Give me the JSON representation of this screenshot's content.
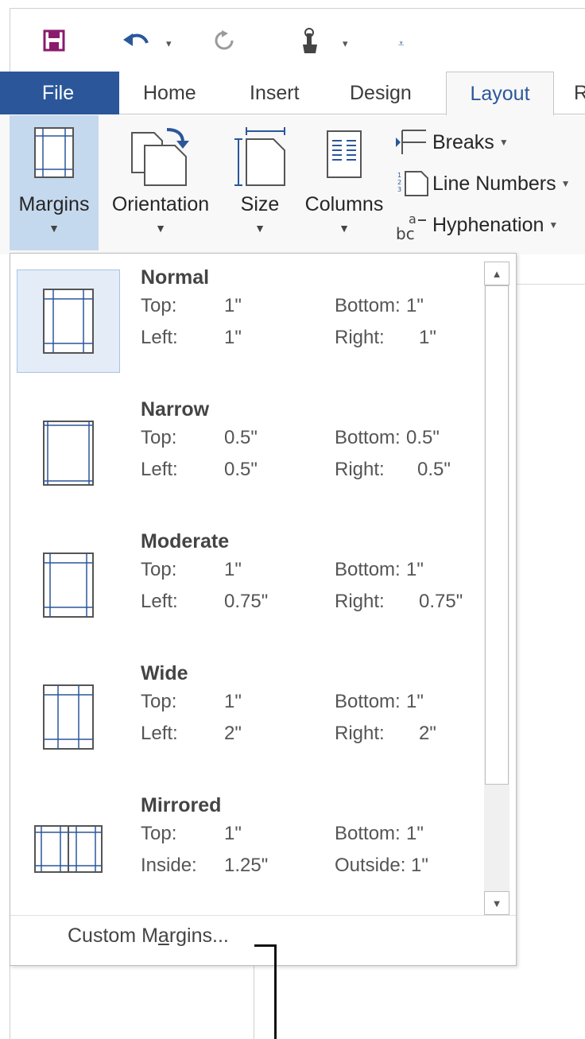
{
  "quick_access": {
    "save_icon": "save-icon",
    "undo_icon": "undo-icon",
    "redo_icon": "redo-icon",
    "touch_icon": "touch-mode-icon",
    "customize_icon": "customize-icon"
  },
  "tabs": {
    "file": "File",
    "home": "Home",
    "insert": "Insert",
    "design": "Design",
    "layout": "Layout",
    "next": "R"
  },
  "ribbon": {
    "margins": "Margins",
    "orientation": "Orientation",
    "size": "Size",
    "columns": "Columns",
    "breaks": "Breaks",
    "line_numbers": "Line Numbers",
    "hyphenation": "Hyphenation"
  },
  "margins_gallery": {
    "items": [
      {
        "name": "Normal",
        "k1": "Top:",
        "v1": "1\"",
        "k2": "Bottom:",
        "v2": "1\"",
        "k3": "Left:",
        "v3": "1\"",
        "k4": "Right:",
        "v4": "1\""
      },
      {
        "name": "Narrow",
        "k1": "Top:",
        "v1": "0.5\"",
        "k2": "Bottom:",
        "v2": "0.5\"",
        "k3": "Left:",
        "v3": "0.5\"",
        "k4": "Right:",
        "v4": "0.5\""
      },
      {
        "name": "Moderate",
        "k1": "Top:",
        "v1": "1\"",
        "k2": "Bottom:",
        "v2": "1\"",
        "k3": "Left:",
        "v3": "0.75\"",
        "k4": "Right:",
        "v4": "0.75\""
      },
      {
        "name": "Wide",
        "k1": "Top:",
        "v1": "1\"",
        "k2": "Bottom:",
        "v2": "1\"",
        "k3": "Left:",
        "v3": "2\"",
        "k4": "Right:",
        "v4": "2\""
      },
      {
        "name": "Mirrored",
        "k1": "Top:",
        "v1": "1\"",
        "k2": "Bottom:",
        "v2": "1\"",
        "k3": "Inside:",
        "v3": "1.25\"",
        "k4": "Outside:",
        "v4": "1\""
      }
    ],
    "custom_margins_pre": "Custom M",
    "custom_margins_underlined": "a",
    "custom_margins_post": "rgins..."
  },
  "colors": {
    "file_tab": "#2b579a",
    "active_tab_text": "#2b579a",
    "selected_button": "#c5d9ee",
    "selected_item": "#e3ecf7",
    "save_icon": "#8a1b6c"
  }
}
